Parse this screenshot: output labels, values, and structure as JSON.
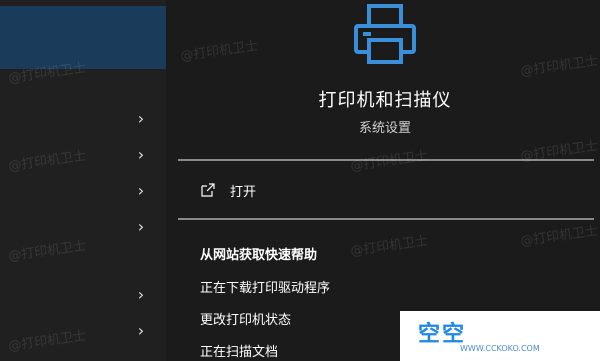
{
  "device": {
    "title": "打印机和扫描仪",
    "subtitle": "系统设置"
  },
  "actions": {
    "open_label": "打开"
  },
  "help": {
    "heading": "从网站获取快速帮助",
    "links": [
      "正在下载打印驱动程序",
      "更改打印机状态",
      "正在扫描文档"
    ]
  },
  "watermark": "@打印机卫士",
  "logo": {
    "text": "空空",
    "sub": "WWW.CCKOKO.COM"
  },
  "colors": {
    "accent": "#3a8fd8",
    "selected_bg": "#1b3b5a",
    "panel_bg": "#1b1b1b"
  },
  "icons": [
    "printer-icon",
    "open-external-icon",
    "chevron-right-icon"
  ]
}
